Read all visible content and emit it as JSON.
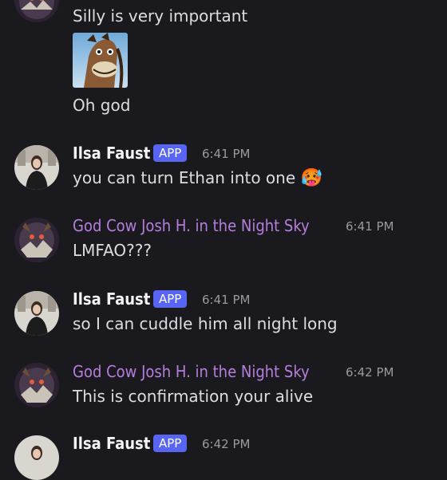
{
  "messages": {
    "m0": {
      "text": "Silly is very important"
    },
    "m0b": {
      "text": "Oh god"
    },
    "m1": {
      "author": "Ilsa Faust",
      "badge": "APP",
      "time": "6:41 PM",
      "text": "you can turn Ethan into one",
      "emoji": "🥵"
    },
    "m2": {
      "author": "God Cow Josh H. in the Night Sky",
      "time": "6:41 PM",
      "text": "LMFAO???"
    },
    "m3": {
      "author": "Ilsa Faust",
      "badge": "APP",
      "time": "6:41 PM",
      "text": "so I can cuddle him all night long"
    },
    "m4": {
      "author": "God Cow Josh H. in the Night Sky",
      "time": "6:42 PM",
      "text": "This is confirmation your alive"
    },
    "m5": {
      "author": "Ilsa Faust",
      "badge": "APP",
      "time": "6:42 PM"
    }
  },
  "colors": {
    "background": "#1a1a1e",
    "app_badge": "#5865f2",
    "cow_name": "#b57edc",
    "timestamp": "#989aa2"
  },
  "icons": {
    "ilsa_avatar": "woman-portrait-avatar",
    "cow_avatar": "monster-avatar",
    "attachment": "horse-face-image"
  }
}
